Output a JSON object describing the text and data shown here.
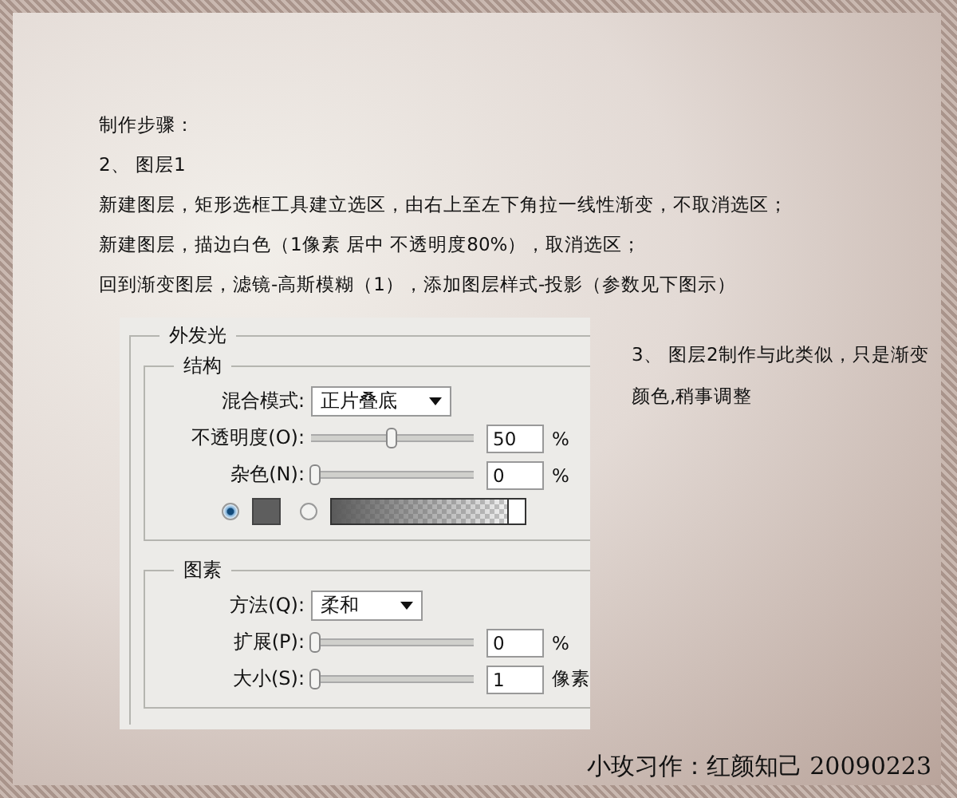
{
  "steps": {
    "heading": "制作步骤：",
    "layer": "2、 图层1",
    "lines": [
      "新建图层，矩形选框工具建立选区，由右上至左下角拉一线性渐变，不取消选区；",
      "新建图层，描边白色（1像素 居中 不透明度80%），取消选区；",
      "回到渐变图层，滤镜-高斯模糊（1），添加图层样式-投影（参数见下图示）"
    ]
  },
  "dialog": {
    "title": "外发光",
    "structure": {
      "title": "结构",
      "blend_label": "混合模式:",
      "blend_value": "正片叠底",
      "sliders": [
        {
          "label": "不透明度(O):",
          "level": 0.5,
          "value": "50",
          "unit": "%"
        },
        {
          "label": "杂色(N):",
          "level": 0,
          "value": "0",
          "unit": "%"
        }
      ],
      "fill": [
        {
          "kind": "color",
          "selected": true
        },
        {
          "kind": "gradient",
          "selected": false
        }
      ]
    },
    "elements": {
      "title": "图素",
      "method_label": "方法(Q):",
      "method_value": "柔和",
      "sliders": [
        {
          "label": "扩展(P):",
          "level": 0,
          "value": "0",
          "unit": "%"
        },
        {
          "label": "大小(S):",
          "level": 0,
          "value": "1",
          "unit": "像素"
        }
      ]
    }
  },
  "note": "3、 图层2制作与此类似，只是渐变颜色,稍事调整",
  "signature": "小玫习作：红颜知己 20090223"
}
